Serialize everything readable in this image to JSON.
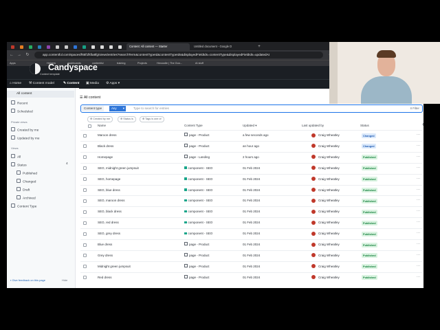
{
  "browser": {
    "tabs": [
      {
        "title": "Content: All content — Starter",
        "active": true
      },
      {
        "title": "Untitled document - Google D",
        "active": false
      }
    ],
    "new_tab": "+",
    "url": "app.contentful.com/spaces/f65f1fkfia8fg/views/entries?searchTerm&contentTypeId&contentTypeIds&displayedFieldIds=contentType&displayedFieldIds=updatedAt",
    "bookmarks": [
      "Apps",
      "Helpers",
      "dashboards",
      "contentful",
      "training",
      "Projects",
      "Hexoodle | The Goo...",
      "AI stuff"
    ]
  },
  "app": {
    "brand_line": "Content template",
    "overlay_brand": "Candyspace",
    "nav": [
      {
        "label": "Home",
        "icon": "home-icon"
      },
      {
        "label": "Content model",
        "icon": "wrench-icon"
      },
      {
        "label": "Content",
        "icon": "pencil-icon",
        "active": true
      },
      {
        "label": "Media",
        "icon": "image-icon"
      },
      {
        "label": "Apps",
        "icon": "apps-icon"
      }
    ]
  },
  "sidebar": {
    "all_content": "All content",
    "recent": "Recent",
    "scheduled": "Scheduled",
    "private_views_heading": "Private views",
    "created_by_me": "Created by me",
    "updated_by_me": "Updated by me",
    "views_heading": "Views",
    "all": "All",
    "status": "Status",
    "status_count": "4",
    "published": "Published",
    "changed": "Changed",
    "draft": "Draft",
    "archived": "Archived",
    "content_type": "Content Type",
    "feedback": "Give feedback on this page",
    "hide": "Hide"
  },
  "main": {
    "title": "All content",
    "search": {
      "content_type_label": "Content type",
      "any": "Any",
      "placeholder": "Type to search for entries",
      "filter": "Filter"
    },
    "filter_pills": [
      "Created by me",
      "Status is",
      "Tags is one of"
    ],
    "columns": [
      "Name",
      "Content Type",
      "Updated",
      "Last updated by",
      "Status"
    ],
    "rows": [
      {
        "name": "Maroon dress",
        "type": "page - Product",
        "updated": "a few seconds ago",
        "by": "Craig Wheatley",
        "status": "Changed"
      },
      {
        "name": "Black dress",
        "type": "page - Product",
        "updated": "an hour ago",
        "by": "Craig Wheatley",
        "status": "Changed"
      },
      {
        "name": "Homepage",
        "type": "page - Landing",
        "updated": "2 hours ago",
        "by": "Craig Wheatley",
        "status": "Published"
      },
      {
        "name": "SEO, midnight green jumpsuit",
        "type": "component - SEO",
        "updated": "01 Feb 2024",
        "by": "Craig Wheatley",
        "status": "Published"
      },
      {
        "name": "SEO, homepage",
        "type": "component - SEO",
        "updated": "01 Feb 2024",
        "by": "Craig Wheatley",
        "status": "Published"
      },
      {
        "name": "SEO, blue dress",
        "type": "component - SEO",
        "updated": "01 Feb 2024",
        "by": "Craig Wheatley",
        "status": "Published"
      },
      {
        "name": "SEO, maroon dress",
        "type": "component - SEO",
        "updated": "01 Feb 2024",
        "by": "Craig Wheatley",
        "status": "Published"
      },
      {
        "name": "SEO, black dress",
        "type": "component - SEO",
        "updated": "01 Feb 2024",
        "by": "Craig Wheatley",
        "status": "Published"
      },
      {
        "name": "SEO, red dress",
        "type": "component - SEO",
        "updated": "01 Feb 2024",
        "by": "Craig Wheatley",
        "status": "Published"
      },
      {
        "name": "SEO, grey dress",
        "type": "component - SEO",
        "updated": "01 Feb 2024",
        "by": "Craig Wheatley",
        "status": "Published"
      },
      {
        "name": "Blue dress",
        "type": "page - Product",
        "updated": "01 Feb 2024",
        "by": "Craig Wheatley",
        "status": "Published"
      },
      {
        "name": "Grey dress",
        "type": "page - Product",
        "updated": "01 Feb 2024",
        "by": "Craig Wheatley",
        "status": "Published"
      },
      {
        "name": "Midnight green jumpsuit",
        "type": "page - Product",
        "updated": "01 Feb 2024",
        "by": "Craig Wheatley",
        "status": "Published"
      },
      {
        "name": "Red dress",
        "type": "page - Product",
        "updated": "01 Feb 2024",
        "by": "Craig Wheatley",
        "status": "Published"
      }
    ]
  },
  "colors": {
    "accent": "#2e75d8",
    "changed_bg": "#dbe9fb",
    "changed_fg": "#1f5bb3",
    "published_bg": "#daf3e1",
    "published_fg": "#13803b"
  }
}
